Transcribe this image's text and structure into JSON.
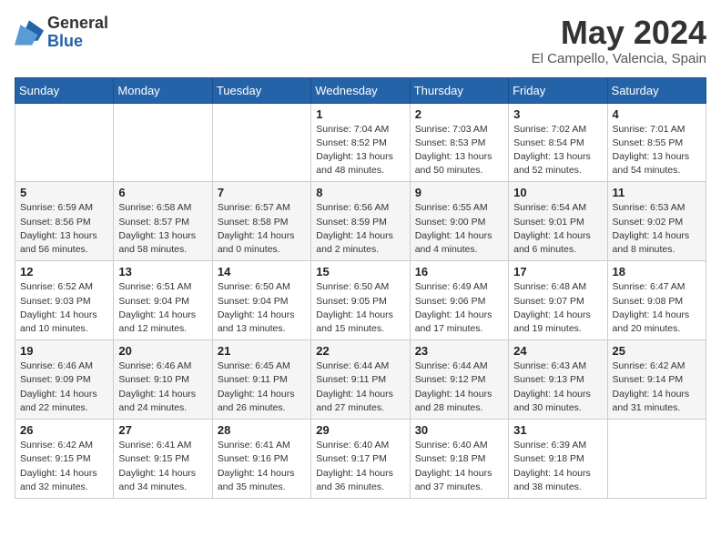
{
  "logo": {
    "general": "General",
    "blue": "Blue"
  },
  "title": "May 2024",
  "location": "El Campello, Valencia, Spain",
  "days_header": [
    "Sunday",
    "Monday",
    "Tuesday",
    "Wednesday",
    "Thursday",
    "Friday",
    "Saturday"
  ],
  "weeks": [
    [
      {
        "day": "",
        "info": ""
      },
      {
        "day": "",
        "info": ""
      },
      {
        "day": "",
        "info": ""
      },
      {
        "day": "1",
        "info": "Sunrise: 7:04 AM\nSunset: 8:52 PM\nDaylight: 13 hours\nand 48 minutes."
      },
      {
        "day": "2",
        "info": "Sunrise: 7:03 AM\nSunset: 8:53 PM\nDaylight: 13 hours\nand 50 minutes."
      },
      {
        "day": "3",
        "info": "Sunrise: 7:02 AM\nSunset: 8:54 PM\nDaylight: 13 hours\nand 52 minutes."
      },
      {
        "day": "4",
        "info": "Sunrise: 7:01 AM\nSunset: 8:55 PM\nDaylight: 13 hours\nand 54 minutes."
      }
    ],
    [
      {
        "day": "5",
        "info": "Sunrise: 6:59 AM\nSunset: 8:56 PM\nDaylight: 13 hours\nand 56 minutes."
      },
      {
        "day": "6",
        "info": "Sunrise: 6:58 AM\nSunset: 8:57 PM\nDaylight: 13 hours\nand 58 minutes."
      },
      {
        "day": "7",
        "info": "Sunrise: 6:57 AM\nSunset: 8:58 PM\nDaylight: 14 hours\nand 0 minutes."
      },
      {
        "day": "8",
        "info": "Sunrise: 6:56 AM\nSunset: 8:59 PM\nDaylight: 14 hours\nand 2 minutes."
      },
      {
        "day": "9",
        "info": "Sunrise: 6:55 AM\nSunset: 9:00 PM\nDaylight: 14 hours\nand 4 minutes."
      },
      {
        "day": "10",
        "info": "Sunrise: 6:54 AM\nSunset: 9:01 PM\nDaylight: 14 hours\nand 6 minutes."
      },
      {
        "day": "11",
        "info": "Sunrise: 6:53 AM\nSunset: 9:02 PM\nDaylight: 14 hours\nand 8 minutes."
      }
    ],
    [
      {
        "day": "12",
        "info": "Sunrise: 6:52 AM\nSunset: 9:03 PM\nDaylight: 14 hours\nand 10 minutes."
      },
      {
        "day": "13",
        "info": "Sunrise: 6:51 AM\nSunset: 9:04 PM\nDaylight: 14 hours\nand 12 minutes."
      },
      {
        "day": "14",
        "info": "Sunrise: 6:50 AM\nSunset: 9:04 PM\nDaylight: 14 hours\nand 13 minutes."
      },
      {
        "day": "15",
        "info": "Sunrise: 6:50 AM\nSunset: 9:05 PM\nDaylight: 14 hours\nand 15 minutes."
      },
      {
        "day": "16",
        "info": "Sunrise: 6:49 AM\nSunset: 9:06 PM\nDaylight: 14 hours\nand 17 minutes."
      },
      {
        "day": "17",
        "info": "Sunrise: 6:48 AM\nSunset: 9:07 PM\nDaylight: 14 hours\nand 19 minutes."
      },
      {
        "day": "18",
        "info": "Sunrise: 6:47 AM\nSunset: 9:08 PM\nDaylight: 14 hours\nand 20 minutes."
      }
    ],
    [
      {
        "day": "19",
        "info": "Sunrise: 6:46 AM\nSunset: 9:09 PM\nDaylight: 14 hours\nand 22 minutes."
      },
      {
        "day": "20",
        "info": "Sunrise: 6:46 AM\nSunset: 9:10 PM\nDaylight: 14 hours\nand 24 minutes."
      },
      {
        "day": "21",
        "info": "Sunrise: 6:45 AM\nSunset: 9:11 PM\nDaylight: 14 hours\nand 26 minutes."
      },
      {
        "day": "22",
        "info": "Sunrise: 6:44 AM\nSunset: 9:11 PM\nDaylight: 14 hours\nand 27 minutes."
      },
      {
        "day": "23",
        "info": "Sunrise: 6:44 AM\nSunset: 9:12 PM\nDaylight: 14 hours\nand 28 minutes."
      },
      {
        "day": "24",
        "info": "Sunrise: 6:43 AM\nSunset: 9:13 PM\nDaylight: 14 hours\nand 30 minutes."
      },
      {
        "day": "25",
        "info": "Sunrise: 6:42 AM\nSunset: 9:14 PM\nDaylight: 14 hours\nand 31 minutes."
      }
    ],
    [
      {
        "day": "26",
        "info": "Sunrise: 6:42 AM\nSunset: 9:15 PM\nDaylight: 14 hours\nand 32 minutes."
      },
      {
        "day": "27",
        "info": "Sunrise: 6:41 AM\nSunset: 9:15 PM\nDaylight: 14 hours\nand 34 minutes."
      },
      {
        "day": "28",
        "info": "Sunrise: 6:41 AM\nSunset: 9:16 PM\nDaylight: 14 hours\nand 35 minutes."
      },
      {
        "day": "29",
        "info": "Sunrise: 6:40 AM\nSunset: 9:17 PM\nDaylight: 14 hours\nand 36 minutes."
      },
      {
        "day": "30",
        "info": "Sunrise: 6:40 AM\nSunset: 9:18 PM\nDaylight: 14 hours\nand 37 minutes."
      },
      {
        "day": "31",
        "info": "Sunrise: 6:39 AM\nSunset: 9:18 PM\nDaylight: 14 hours\nand 38 minutes."
      },
      {
        "day": "",
        "info": ""
      }
    ]
  ]
}
